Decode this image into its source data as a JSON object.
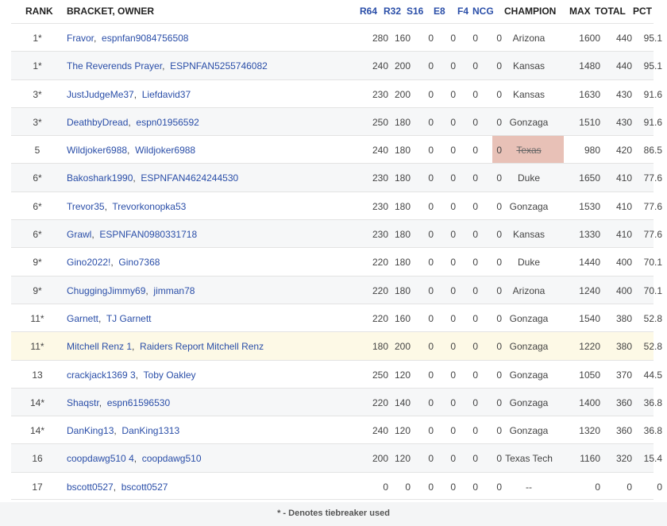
{
  "headers": {
    "rank": "RANK",
    "bracket": "BRACKET, OWNER",
    "r64": "R64",
    "r32": "R32",
    "s16": "S16",
    "e8": "E8",
    "f4": "F4",
    "ncg": "NCG",
    "champion": "CHAMPION",
    "max": "MAX",
    "total": "TOTAL",
    "pct": "PCT"
  },
  "colors": {
    "link": "#2a4ea8",
    "eliminated_champion_bg": "#e8c1b7",
    "highlight_row_bg": "#fdf9e6"
  },
  "rows": [
    {
      "rank": "1*",
      "bracket": "Fravor",
      "owner": "espnfan9084756508",
      "r64": "280",
      "r32": "160",
      "s16": "0",
      "e8": "0",
      "f4": "0",
      "ncg": "0",
      "champion": "Arizona",
      "eliminated": false,
      "max": "1600",
      "total": "440",
      "pct": "95.1",
      "highlight": false
    },
    {
      "rank": "1*",
      "bracket": "The Reverends Prayer",
      "owner": "ESPNFAN5255746082",
      "r64": "240",
      "r32": "200",
      "s16": "0",
      "e8": "0",
      "f4": "0",
      "ncg": "0",
      "champion": "Kansas",
      "eliminated": false,
      "max": "1480",
      "total": "440",
      "pct": "95.1",
      "highlight": false
    },
    {
      "rank": "3*",
      "bracket": "JustJudgeMe37",
      "owner": "Liefdavid37",
      "r64": "230",
      "r32": "200",
      "s16": "0",
      "e8": "0",
      "f4": "0",
      "ncg": "0",
      "champion": "Kansas",
      "eliminated": false,
      "max": "1630",
      "total": "430",
      "pct": "91.6",
      "highlight": false
    },
    {
      "rank": "3*",
      "bracket": "DeathbyDread",
      "owner": "espn01956592",
      "r64": "250",
      "r32": "180",
      "s16": "0",
      "e8": "0",
      "f4": "0",
      "ncg": "0",
      "champion": "Gonzaga",
      "eliminated": false,
      "max": "1510",
      "total": "430",
      "pct": "91.6",
      "highlight": false
    },
    {
      "rank": "5",
      "bracket": "Wildjoker6988",
      "owner": "Wildjoker6988",
      "r64": "240",
      "r32": "180",
      "s16": "0",
      "e8": "0",
      "f4": "0",
      "ncg": "0",
      "champion": "Texas",
      "eliminated": true,
      "max": "980",
      "total": "420",
      "pct": "86.5",
      "highlight": false
    },
    {
      "rank": "6*",
      "bracket": "Bakoshark1990",
      "owner": "ESPNFAN4624244530",
      "r64": "230",
      "r32": "180",
      "s16": "0",
      "e8": "0",
      "f4": "0",
      "ncg": "0",
      "champion": "Duke",
      "eliminated": false,
      "max": "1650",
      "total": "410",
      "pct": "77.6",
      "highlight": false
    },
    {
      "rank": "6*",
      "bracket": "Trevor35",
      "owner": "Trevorkonopka53",
      "r64": "230",
      "r32": "180",
      "s16": "0",
      "e8": "0",
      "f4": "0",
      "ncg": "0",
      "champion": "Gonzaga",
      "eliminated": false,
      "max": "1530",
      "total": "410",
      "pct": "77.6",
      "highlight": false
    },
    {
      "rank": "6*",
      "bracket": "Grawl",
      "owner": "ESPNFAN0980331718",
      "r64": "230",
      "r32": "180",
      "s16": "0",
      "e8": "0",
      "f4": "0",
      "ncg": "0",
      "champion": "Kansas",
      "eliminated": false,
      "max": "1330",
      "total": "410",
      "pct": "77.6",
      "highlight": false
    },
    {
      "rank": "9*",
      "bracket": "Gino2022!",
      "owner": "Gino7368",
      "r64": "220",
      "r32": "180",
      "s16": "0",
      "e8": "0",
      "f4": "0",
      "ncg": "0",
      "champion": "Duke",
      "eliminated": false,
      "max": "1440",
      "total": "400",
      "pct": "70.1",
      "highlight": false
    },
    {
      "rank": "9*",
      "bracket": "ChuggingJimmy69",
      "owner": "jimman78",
      "r64": "220",
      "r32": "180",
      "s16": "0",
      "e8": "0",
      "f4": "0",
      "ncg": "0",
      "champion": "Arizona",
      "eliminated": false,
      "max": "1240",
      "total": "400",
      "pct": "70.1",
      "highlight": false
    },
    {
      "rank": "11*",
      "bracket": "Garnett",
      "owner": "TJ Garnett",
      "r64": "220",
      "r32": "160",
      "s16": "0",
      "e8": "0",
      "f4": "0",
      "ncg": "0",
      "champion": "Gonzaga",
      "eliminated": false,
      "max": "1540",
      "total": "380",
      "pct": "52.8",
      "highlight": false
    },
    {
      "rank": "11*",
      "bracket": "Mitchell Renz 1",
      "owner": "Raiders Report Mitchell Renz",
      "r64": "180",
      "r32": "200",
      "s16": "0",
      "e8": "0",
      "f4": "0",
      "ncg": "0",
      "champion": "Gonzaga",
      "eliminated": false,
      "max": "1220",
      "total": "380",
      "pct": "52.8",
      "highlight": true
    },
    {
      "rank": "13",
      "bracket": "crackjack1369 3",
      "owner": "Toby Oakley",
      "r64": "250",
      "r32": "120",
      "s16": "0",
      "e8": "0",
      "f4": "0",
      "ncg": "0",
      "champion": "Gonzaga",
      "eliminated": false,
      "max": "1050",
      "total": "370",
      "pct": "44.5",
      "highlight": false
    },
    {
      "rank": "14*",
      "bracket": "Shaqstr",
      "owner": "espn61596530",
      "r64": "220",
      "r32": "140",
      "s16": "0",
      "e8": "0",
      "f4": "0",
      "ncg": "0",
      "champion": "Gonzaga",
      "eliminated": false,
      "max": "1400",
      "total": "360",
      "pct": "36.8",
      "highlight": false
    },
    {
      "rank": "14*",
      "bracket": "DanKing13",
      "owner": "DanKing1313",
      "r64": "240",
      "r32": "120",
      "s16": "0",
      "e8": "0",
      "f4": "0",
      "ncg": "0",
      "champion": "Gonzaga",
      "eliminated": false,
      "max": "1320",
      "total": "360",
      "pct": "36.8",
      "highlight": false
    },
    {
      "rank": "16",
      "bracket": "coopdawg510 4",
      "owner": "coopdawg510",
      "r64": "200",
      "r32": "120",
      "s16": "0",
      "e8": "0",
      "f4": "0",
      "ncg": "0",
      "champion": "Texas Tech",
      "eliminated": false,
      "max": "1160",
      "total": "320",
      "pct": "15.4",
      "highlight": false
    },
    {
      "rank": "17",
      "bracket": "bscott0527",
      "owner": "bscott0527",
      "r64": "0",
      "r32": "0",
      "s16": "0",
      "e8": "0",
      "f4": "0",
      "ncg": "0",
      "champion": "--",
      "eliminated": false,
      "max": "0",
      "total": "0",
      "pct": "0",
      "highlight": false
    }
  ],
  "footer": {
    "note": "* - Denotes tiebreaker used"
  }
}
